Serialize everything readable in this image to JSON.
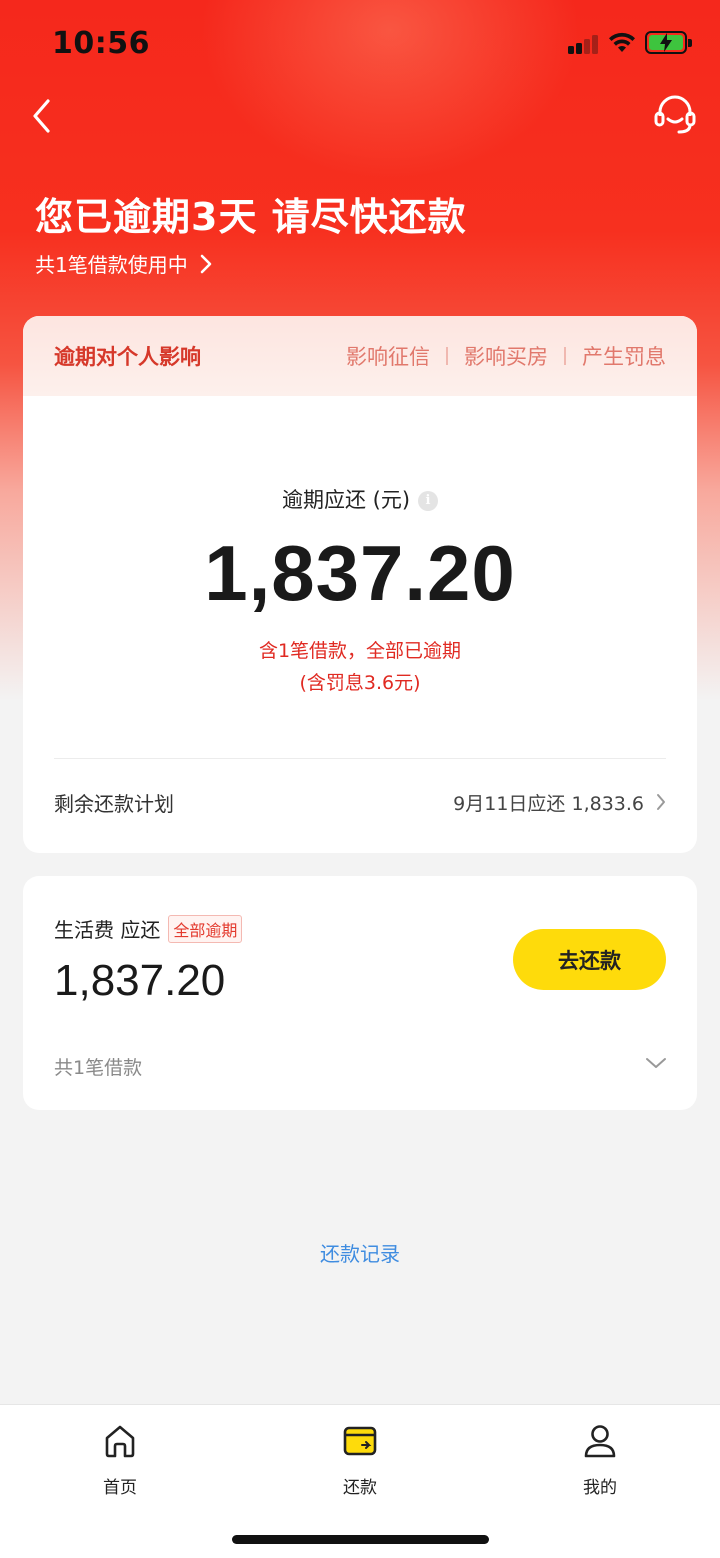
{
  "status_bar": {
    "time": "10:56"
  },
  "colors": {
    "brand_red": "#f5281c",
    "accent_yellow": "#fedb0b",
    "overdue_red": "#e02a22",
    "link_blue": "#3f8ce0"
  },
  "header": {
    "title": "您已逾期3天 请尽快还款",
    "subtitle": "共1笔借款使用中",
    "back_icon": "chevron-left-icon",
    "service_icon": "headset-icon"
  },
  "impact": {
    "label": "逾期对个人影响",
    "items": [
      "影响征信",
      "影响买房",
      "产生罚息"
    ]
  },
  "overdue": {
    "label": "逾期应还 (元)",
    "info_glyph": "i",
    "amount": "1,837.20",
    "note_line1": "含1笔借款，全部已逾期",
    "note_line2": "(含罚息3.6元)"
  },
  "plan": {
    "label": "剩余还款计划",
    "value": "9月11日应还 1,833.6"
  },
  "loan": {
    "title": "生活费 应还",
    "badge": "全部逾期",
    "amount": "1,837.20",
    "pay_button": "去还款",
    "count": "共1笔借款"
  },
  "record_link": "还款记录",
  "tabbar": {
    "items": [
      {
        "label": "首页",
        "icon": "home-icon"
      },
      {
        "label": "还款",
        "icon": "wallet-icon"
      },
      {
        "label": "我的",
        "icon": "user-icon"
      }
    ]
  }
}
